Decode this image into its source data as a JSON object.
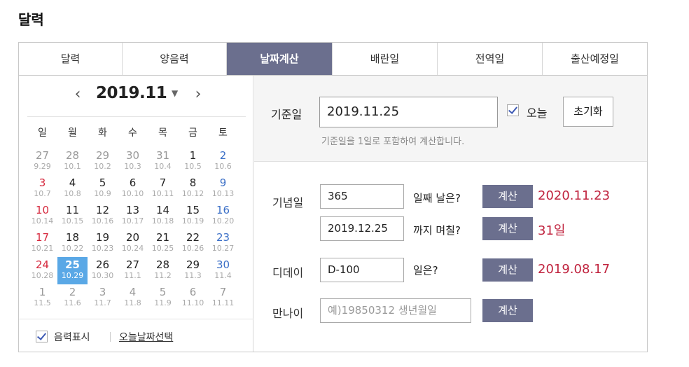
{
  "page_title": "달력",
  "tabs": [
    {
      "label": "달력",
      "active": false
    },
    {
      "label": "양음력",
      "active": false
    },
    {
      "label": "날짜계산",
      "active": true
    },
    {
      "label": "배란일",
      "active": false
    },
    {
      "label": "전역일",
      "active": false
    },
    {
      "label": "출산예정일",
      "active": false
    }
  ],
  "calendar": {
    "prev_icon": "‹",
    "next_icon": "›",
    "month": "2019.11",
    "caret_icon": "▼",
    "weekdays": [
      "일",
      "월",
      "화",
      "수",
      "목",
      "금",
      "토"
    ],
    "weeks": [
      [
        {
          "d": "27",
          "l": "9.29",
          "o": true
        },
        {
          "d": "28",
          "l": "10.1",
          "o": true
        },
        {
          "d": "29",
          "l": "10.2",
          "o": true
        },
        {
          "d": "30",
          "l": "10.3",
          "o": true
        },
        {
          "d": "31",
          "l": "10.4",
          "o": true
        },
        {
          "d": "1",
          "l": "10.5"
        },
        {
          "d": "2",
          "l": "10.6"
        }
      ],
      [
        {
          "d": "3",
          "l": "10.7"
        },
        {
          "d": "4",
          "l": "10.8"
        },
        {
          "d": "5",
          "l": "10.9"
        },
        {
          "d": "6",
          "l": "10.10"
        },
        {
          "d": "7",
          "l": "10.11"
        },
        {
          "d": "8",
          "l": "10.12"
        },
        {
          "d": "9",
          "l": "10.13"
        }
      ],
      [
        {
          "d": "10",
          "l": "10.14"
        },
        {
          "d": "11",
          "l": "10.15"
        },
        {
          "d": "12",
          "l": "10.16"
        },
        {
          "d": "13",
          "l": "10.17"
        },
        {
          "d": "14",
          "l": "10.18"
        },
        {
          "d": "15",
          "l": "10.19"
        },
        {
          "d": "16",
          "l": "10.20"
        }
      ],
      [
        {
          "d": "17",
          "l": "10.21"
        },
        {
          "d": "18",
          "l": "10.22"
        },
        {
          "d": "19",
          "l": "10.23"
        },
        {
          "d": "20",
          "l": "10.24"
        },
        {
          "d": "21",
          "l": "10.25"
        },
        {
          "d": "22",
          "l": "10.26"
        },
        {
          "d": "23",
          "l": "10.27"
        }
      ],
      [
        {
          "d": "24",
          "l": "10.28"
        },
        {
          "d": "25",
          "l": "10.29",
          "sel": true
        },
        {
          "d": "26",
          "l": "10.30"
        },
        {
          "d": "27",
          "l": "11.1"
        },
        {
          "d": "28",
          "l": "11.2"
        },
        {
          "d": "29",
          "l": "11.3"
        },
        {
          "d": "30",
          "l": "11.4"
        }
      ],
      [
        {
          "d": "1",
          "l": "11.5",
          "o": true
        },
        {
          "d": "2",
          "l": "11.6",
          "o": true
        },
        {
          "d": "3",
          "l": "11.7",
          "o": true
        },
        {
          "d": "4",
          "l": "11.8",
          "o": true
        },
        {
          "d": "5",
          "l": "11.9",
          "o": true
        },
        {
          "d": "6",
          "l": "11.10",
          "o": true
        },
        {
          "d": "7",
          "l": "11.11",
          "o": true
        }
      ]
    ],
    "show_lunar_label": "음력표시",
    "show_lunar_checked": true,
    "today_select_link": "오늘날짜선택"
  },
  "base": {
    "label": "기준일",
    "value": "2019.11.25",
    "today_label": "오늘",
    "today_checked": true,
    "reset_label": "초기화",
    "hint": "기준일을 1일로 포함하여 계산합니다."
  },
  "anniversary": {
    "label": "기념일",
    "days_value": "365",
    "days_suffix": "일째 날은?",
    "calc_label": "계산",
    "days_result": "2020.11.23",
    "date_value": "2019.12.25",
    "date_suffix": "까지 며칠?",
    "date_result": "31일"
  },
  "dday": {
    "label": "디데이",
    "value": "D-100",
    "suffix": "일은?",
    "calc_label": "계산",
    "result": "2019.08.17"
  },
  "age": {
    "label": "만나이",
    "placeholder": "예)19850312   생년월일",
    "calc_label": "계산"
  },
  "colors": {
    "accent": "#6b6f8e",
    "selected_day": "#5aa8e6",
    "result": "#c0233e",
    "sunday": "#d6283d",
    "saturday": "#3b6fc7"
  }
}
